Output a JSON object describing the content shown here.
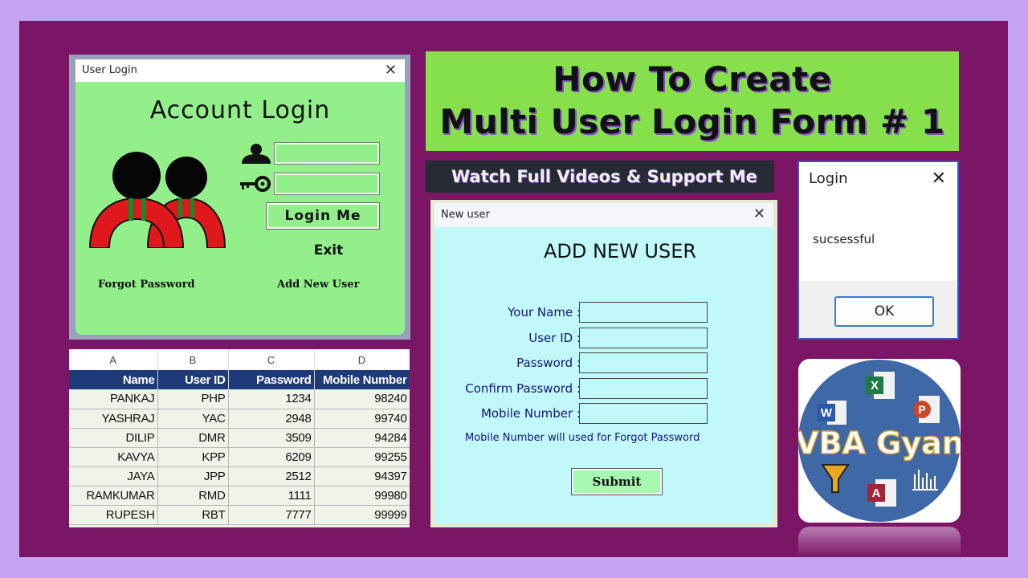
{
  "login_window": {
    "title": "User Login",
    "close": "✕",
    "heading": "Account Login",
    "login_button": "Login Me",
    "exit_label": "Exit",
    "forgot_label": "Forgot Password",
    "add_user_label": "Add New User"
  },
  "banner": {
    "line1": "How To Create",
    "line2": "Multi User Login Form # 1"
  },
  "watch_label": "Watch Full Videos & Support Me",
  "new_user_window": {
    "title": "New user",
    "close": "✕",
    "heading": "ADD NEW USER",
    "fields": [
      {
        "label": "Your Name :"
      },
      {
        "label": "User ID :"
      },
      {
        "label": "Password :"
      },
      {
        "label": "Confirm Password :"
      },
      {
        "label": "Mobile Number :"
      }
    ],
    "note": "Mobile Number will used for Forgot Password",
    "submit": "Submit"
  },
  "message_box": {
    "title": "Login",
    "close": "✕",
    "message": "sucsessful",
    "ok": "OK"
  },
  "sheet": {
    "column_letters": [
      "A",
      "B",
      "C",
      "D"
    ],
    "headers": [
      "Name",
      "User ID",
      "Password",
      "Mobile Number"
    ],
    "rows": [
      [
        "PANKAJ",
        "PHP",
        "1234",
        "98240"
      ],
      [
        "YASHRAJ",
        "YAC",
        "2948",
        "99740"
      ],
      [
        "DILIP",
        "DMR",
        "3509",
        "94284"
      ],
      [
        "KAVYA",
        "KPP",
        "6209",
        "99255"
      ],
      [
        "JAYA",
        "JPP",
        "2512",
        "94397"
      ],
      [
        "RAMKUMAR",
        "RMD",
        "1111",
        "99980"
      ],
      [
        "RUPESH",
        "RBT",
        "7777",
        "99999"
      ]
    ]
  },
  "logo": {
    "text": "VBA Gyan",
    "icons": [
      "word-icon",
      "excel-icon",
      "powerpoint-icon",
      "filter-icon",
      "access-icon",
      "chart-icon"
    ],
    "app_letters": {
      "word": "W",
      "excel": "X",
      "powerpoint": "P",
      "access": "A"
    }
  },
  "colors": {
    "background": "#c4a3f2",
    "frame": "#7b1566",
    "login_form": "#92ef8a",
    "banner": "#86e04b",
    "new_user_form": "#c1f9fa",
    "sheet_header": "#1f3a7a"
  }
}
